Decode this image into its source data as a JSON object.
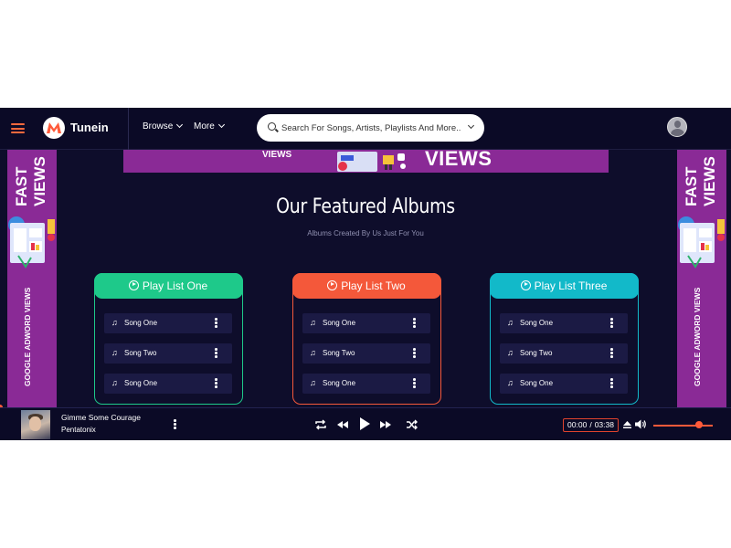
{
  "header": {
    "brand": "Tunein",
    "nav": [
      {
        "label": "Browse"
      },
      {
        "label": "More"
      }
    ],
    "search_placeholder": "Search For Songs, Artists, Playlists And More..."
  },
  "banners": {
    "top_small": "VIEWS",
    "top_large": "VIEWS",
    "side_title": "FAST VIEWS",
    "side_subtitle": "GOOGLE ADWORD VIEWS"
  },
  "section": {
    "title": "Our Featured Albums",
    "subtitle": "Albums Created By Us Just For You"
  },
  "playlists": [
    {
      "title": "Play List One",
      "color": "#1ec98a",
      "songs": [
        "Song One",
        "Song Two",
        "Song One"
      ]
    },
    {
      "title": "Play List Two",
      "color": "#f4583a",
      "songs": [
        "Song One",
        "Song Two",
        "Song One"
      ]
    },
    {
      "title": "Play List Three",
      "color": "#12b9c9",
      "songs": [
        "Song One",
        "Song Two",
        "Song One"
      ]
    }
  ],
  "player": {
    "song_title": "Gimme Some Courage",
    "artist": "Pentatonix",
    "current_time": "00:00",
    "separator": "/",
    "duration": "03:38",
    "volume_fraction": 0.75
  },
  "colors": {
    "background": "#0e0d2b",
    "accent": "#ff5a3a",
    "banner": "#8a2a96"
  },
  "icons": [
    "menu-icon",
    "logo-icon",
    "search-icon",
    "chevron-down-icon",
    "avatar",
    "play-circle-icon",
    "music-note-icon",
    "more-vertical-icon",
    "repeat-icon",
    "rewind-icon",
    "play-icon",
    "fast-forward-icon",
    "shuffle-icon",
    "eject-icon",
    "volume-icon"
  ]
}
